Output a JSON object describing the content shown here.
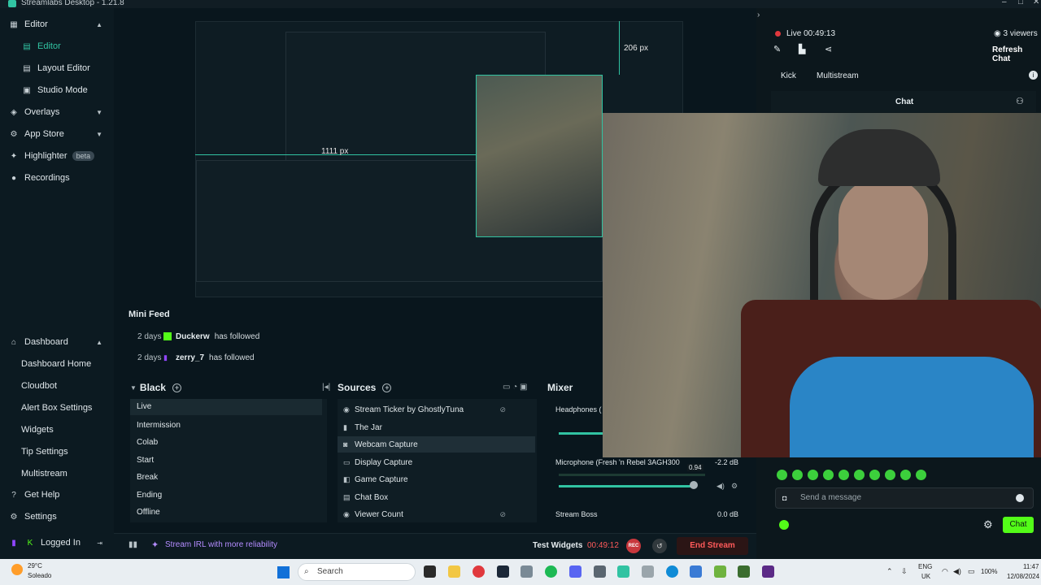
{
  "window": {
    "title": "Streamlabs Desktop - 1.21.8"
  },
  "sidebar": {
    "editor_label": "Editor",
    "editor_sub": [
      "Editor",
      "Layout Editor",
      "Studio Mode"
    ],
    "overlays_label": "Overlays",
    "appstore_label": "App Store",
    "highlighter_label": "Highlighter",
    "highlighter_badge": "beta",
    "recordings_label": "Recordings",
    "dashboard_label": "Dashboard",
    "dashboard_sub": [
      "Dashboard Home",
      "Cloudbot",
      "Alert Box Settings",
      "Widgets",
      "Tip Settings",
      "Multistream"
    ],
    "gethelp_label": "Get Help",
    "settings_label": "Settings",
    "loggedin_label": "Logged In"
  },
  "preview": {
    "px_top": "206 px",
    "px_left": "1111 px"
  },
  "minifeed": {
    "title": "Mini Feed",
    "items": [
      {
        "age": "2 days",
        "name": "Duckerw",
        "action": "has followed"
      },
      {
        "age": "2 days",
        "name": "zerry_7",
        "action": "has followed"
      }
    ]
  },
  "scenes": {
    "title": "Black",
    "items": [
      "Live",
      "Intermission",
      "Colab",
      "Start",
      "Break",
      "Ending",
      "Offline"
    ]
  },
  "sources": {
    "title": "Sources",
    "items": [
      "Stream Ticker by GhostlyTuna",
      "The Jar",
      "Webcam Capture",
      "Display Capture",
      "Game Capture",
      "Chat Box",
      "Viewer Count"
    ]
  },
  "mixer": {
    "title": "Mixer",
    "channels": [
      {
        "name": "Headphones (",
        "db": ""
      },
      {
        "name": "Microphone (Fresh 'n Rebel 3AGH300",
        "db": "-2.2 dB",
        "level": "0.94"
      },
      {
        "name": "Stream Boss",
        "db": "0.0 dB"
      }
    ]
  },
  "bottombar": {
    "stream_irl": "Stream IRL with more reliability",
    "test_widgets": "Test Widgets",
    "timer": "00:49:12",
    "rec": "REC",
    "end_stream": "End Stream"
  },
  "rpanel": {
    "live": "Live 00:49:13",
    "viewers": "3 viewers",
    "refresh": "Refresh Chat",
    "tabs": [
      "Kick",
      "Multistream"
    ],
    "chat_title": "Chat",
    "message_placeholder": "Send a message",
    "chat_button": "Chat"
  },
  "taskbar": {
    "temp": "29°C",
    "weather": "Soleado",
    "search": "Search",
    "lang1": "ENG",
    "lang2": "UK",
    "battery": "100%",
    "time": "11:47",
    "date": "12/08/2024"
  },
  "colors": {
    "accent": "#31c3a2",
    "kick": "#53fc18",
    "danger": "#ff5a5a"
  }
}
